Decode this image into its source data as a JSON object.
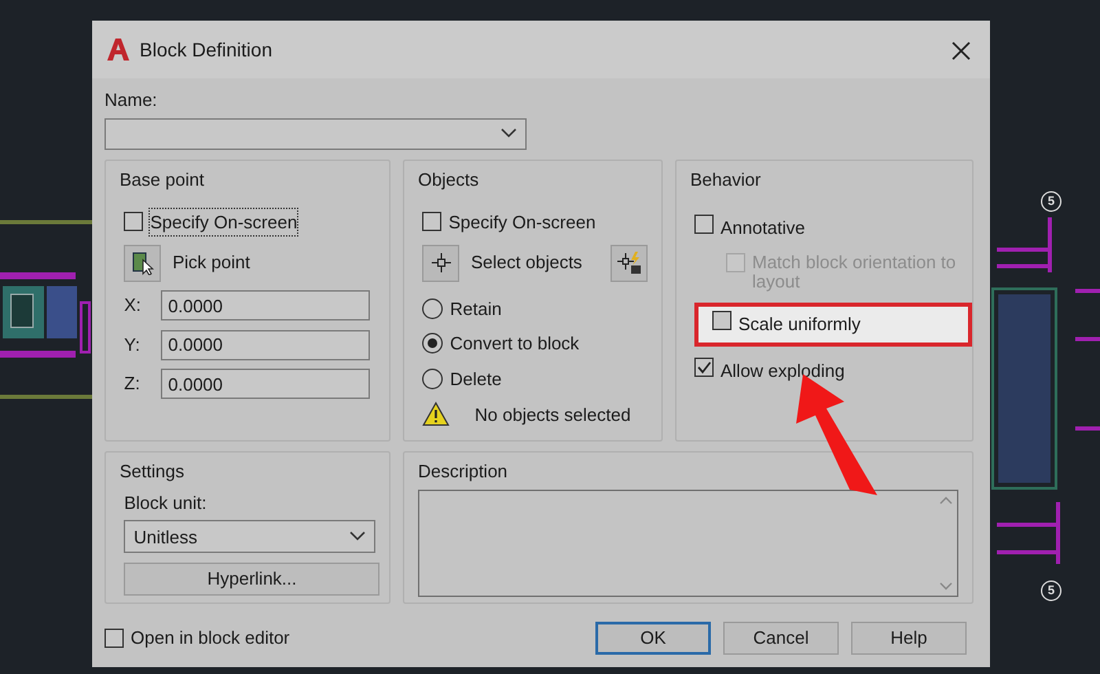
{
  "window": {
    "title": "Block Definition"
  },
  "name_field": {
    "label": "Name:"
  },
  "base_point": {
    "title": "Base point",
    "specify_on_screen": {
      "label": "Specify On-screen",
      "checked": false,
      "focused": true
    },
    "pick_button": "Pick point",
    "coords": [
      {
        "label": "X:",
        "value": "0.0000"
      },
      {
        "label": "Y:",
        "value": "0.0000"
      },
      {
        "label": "Z:",
        "value": "0.0000"
      }
    ]
  },
  "objects": {
    "title": "Objects",
    "specify_on_screen": {
      "label": "Specify On-screen",
      "checked": false
    },
    "select_button": "Select objects",
    "options": [
      {
        "label": "Retain",
        "selected": false
      },
      {
        "label": "Convert to block",
        "selected": true
      },
      {
        "label": "Delete",
        "selected": false
      }
    ],
    "warning": "No objects selected"
  },
  "behavior": {
    "title": "Behavior",
    "options": [
      {
        "label": "Annotative",
        "checked": false,
        "disabled": false,
        "highlighted": false,
        "children": [
          {
            "label": "Match block orientation to layout",
            "checked": false,
            "disabled": true,
            "highlighted": false
          }
        ]
      },
      {
        "label": "Scale uniformly",
        "checked": false,
        "disabled": false,
        "highlighted": true
      },
      {
        "label": "Allow exploding",
        "checked": true,
        "disabled": false,
        "highlighted": false
      }
    ]
  },
  "settings": {
    "title": "Settings",
    "block_unit_label": "Block unit:",
    "block_unit": "Unitless",
    "hyperlink_button": "Hyperlink..."
  },
  "description": {
    "title": "Description"
  },
  "open_in_editor": {
    "label": "Open in block editor",
    "checked": false
  },
  "buttons": [
    {
      "label": "OK",
      "default": true
    },
    {
      "label": "Cancel",
      "default": false
    },
    {
      "label": "Help",
      "default": false
    }
  ],
  "drawing": {
    "grid_labels": [
      "5",
      "5"
    ]
  }
}
